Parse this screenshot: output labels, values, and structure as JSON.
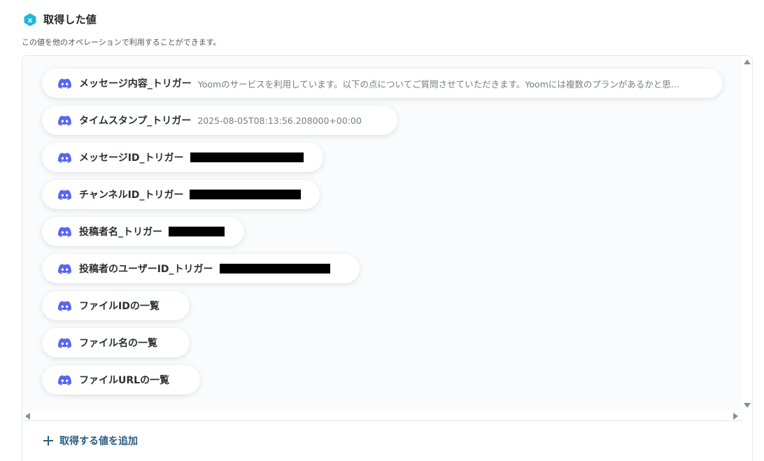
{
  "header": {
    "title": "取得した値",
    "description": "この値を他のオペレーションで利用することができます。",
    "icon": "variable-x-icon",
    "icon_color": "#1eb8d8"
  },
  "values": [
    {
      "label": "メッセージ内容_トリガー",
      "value": "Yoomのサービスを利用しています。以下の点についてご質問させていただきます。Yoomには複数のプランがあるかと思...",
      "redacted": false
    },
    {
      "label": "タイムスタンプ_トリガー",
      "value": "2025-08-05T08:13:56.208000+00:00",
      "redacted": false
    },
    {
      "label": "メッセージID_トリガー",
      "value": "",
      "redacted": true
    },
    {
      "label": "チャンネルID_トリガー",
      "value": "",
      "redacted": true
    },
    {
      "label": "投稿者名_トリガー",
      "value": "",
      "redacted": true
    },
    {
      "label": "投稿者のユーザーID_トリガー",
      "value": "",
      "redacted": true
    },
    {
      "label": "ファイルIDの一覧",
      "value": "",
      "redacted": false
    },
    {
      "label": "ファイル名の一覧",
      "value": "",
      "redacted": false
    },
    {
      "label": "ファイルURLの一覧",
      "value": "",
      "redacted": false
    }
  ],
  "item_icon": "discord-icon",
  "discord_color": "#5865f2",
  "accent_color": "#2a5d82",
  "add_button": {
    "label": "取得する値を追加",
    "icon": "plus-icon"
  }
}
